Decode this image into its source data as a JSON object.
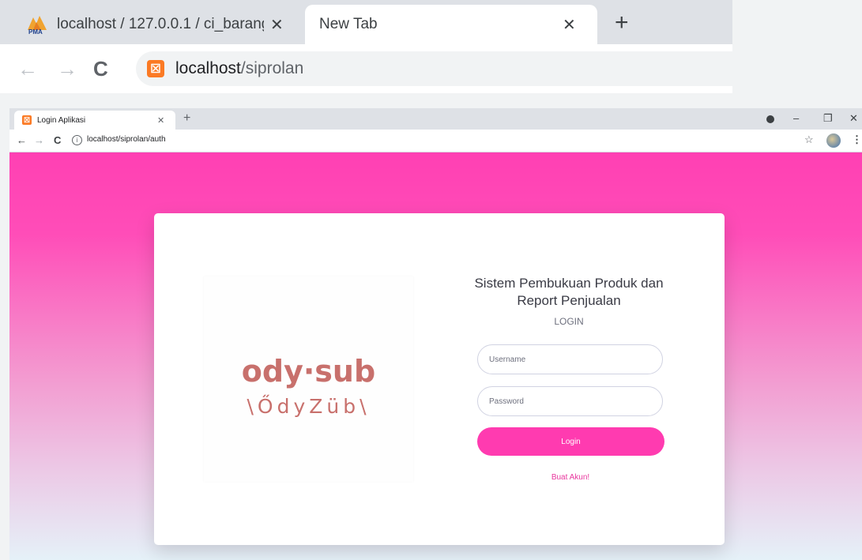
{
  "outer_browser": {
    "tabs": [
      {
        "title": "localhost / 127.0.0.1 / ci_barang |"
      },
      {
        "title": "New Tab"
      }
    ],
    "url_host": "localhost",
    "url_path": "/siprolan"
  },
  "inner_browser": {
    "tab_title": "Login Aplikasi",
    "url": "localhost/siprolan/auth"
  },
  "logo": {
    "main": "ody·sub",
    "sub": "\\ŐdyZüb\\"
  },
  "login": {
    "title": "Sistem Pembukuan Produk dan Report Penjualan",
    "subtitle": "LOGIN",
    "username_placeholder": "Username",
    "password_placeholder": "Password",
    "button_label": "Login",
    "register_link": "Buat Akun!"
  },
  "colors": {
    "accent": "#ff3bb0",
    "logo": "#c8706c"
  }
}
